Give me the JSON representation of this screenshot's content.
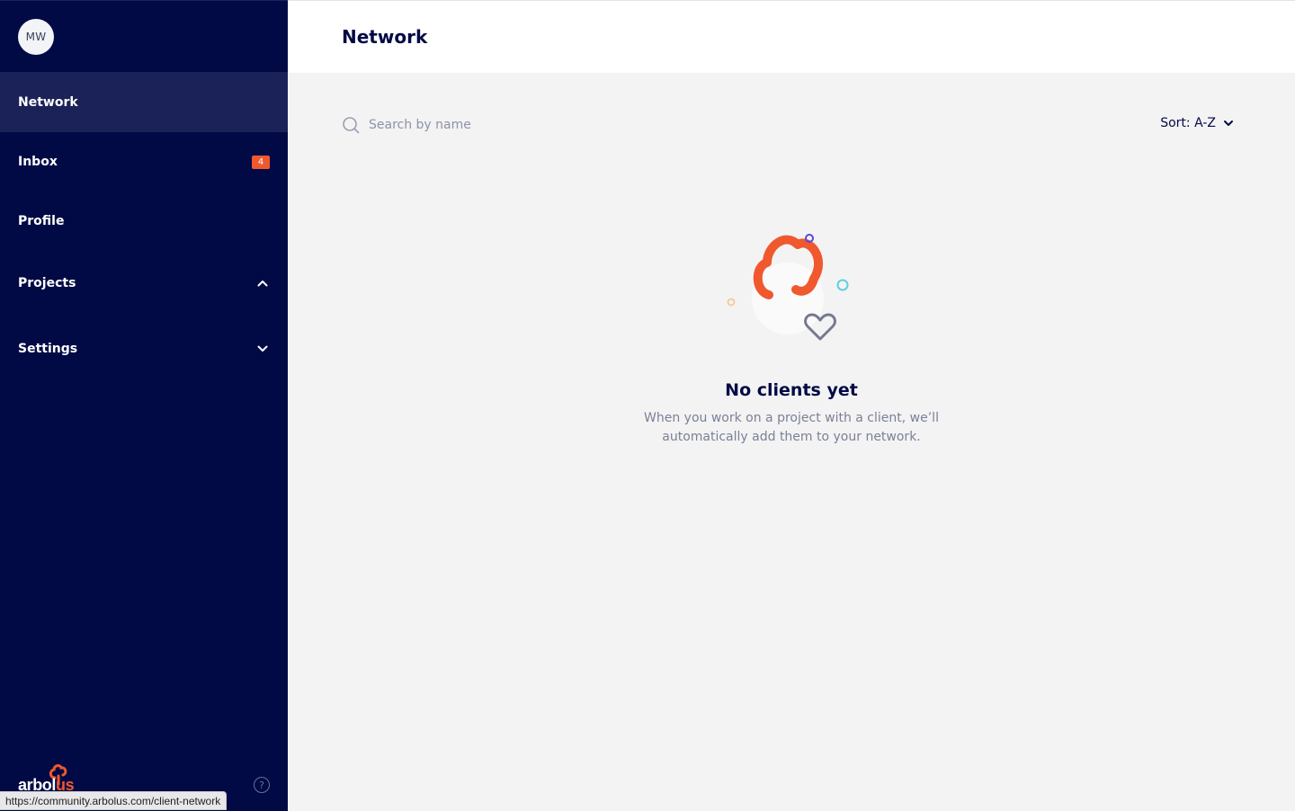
{
  "user": {
    "initials": "MW"
  },
  "sidebar": {
    "items": [
      {
        "label": "Network"
      },
      {
        "label": "Inbox",
        "badge": "4"
      },
      {
        "label": "Profile"
      },
      {
        "label": "Projects"
      },
      {
        "label": "Settings"
      }
    ],
    "logo": {
      "text_main": "arbol",
      "text_accent": "us"
    },
    "help": "?"
  },
  "header": {
    "title": "Network"
  },
  "search": {
    "placeholder": "Search by name"
  },
  "sort": {
    "label": "Sort: A-Z"
  },
  "empty_state": {
    "title": "No clients yet",
    "line1": "When you work on a project with a client, we’ll",
    "line2": "automatically add them to your network."
  },
  "status_bar": {
    "url": "https://community.arbolus.com/client-network"
  },
  "colors": {
    "sidebar_bg": "#020a45",
    "accent": "#f0582e",
    "content_bg": "#f3f3f3"
  }
}
